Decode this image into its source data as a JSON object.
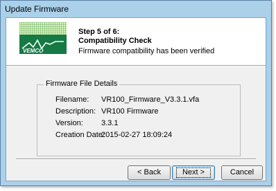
{
  "window": {
    "title": "Update Firmware"
  },
  "header": {
    "step": "Step 5 of 6:",
    "subtitle": "Compatibility Check",
    "description": "Firmware compatibility has been verified",
    "logo_text": "VEMCO"
  },
  "details": {
    "group_label": "Firmware File Details",
    "rows": [
      {
        "label": "Filename:",
        "value": "VR100_Firmware_V3.3.1.vfa"
      },
      {
        "label": "Description:",
        "value": "VR100 Firmware"
      },
      {
        "label": "Version:",
        "value": "3.3.1"
      },
      {
        "label": "Creation Date:",
        "value": "2015-02-27 18:09:24"
      }
    ]
  },
  "buttons": {
    "back": "< Back",
    "next": "Next >",
    "cancel": "Cancel"
  },
  "colors": {
    "titlebar": "#aad0ea",
    "logo_green": "#1c8a4a",
    "logo_dark": "#0a3d22"
  }
}
